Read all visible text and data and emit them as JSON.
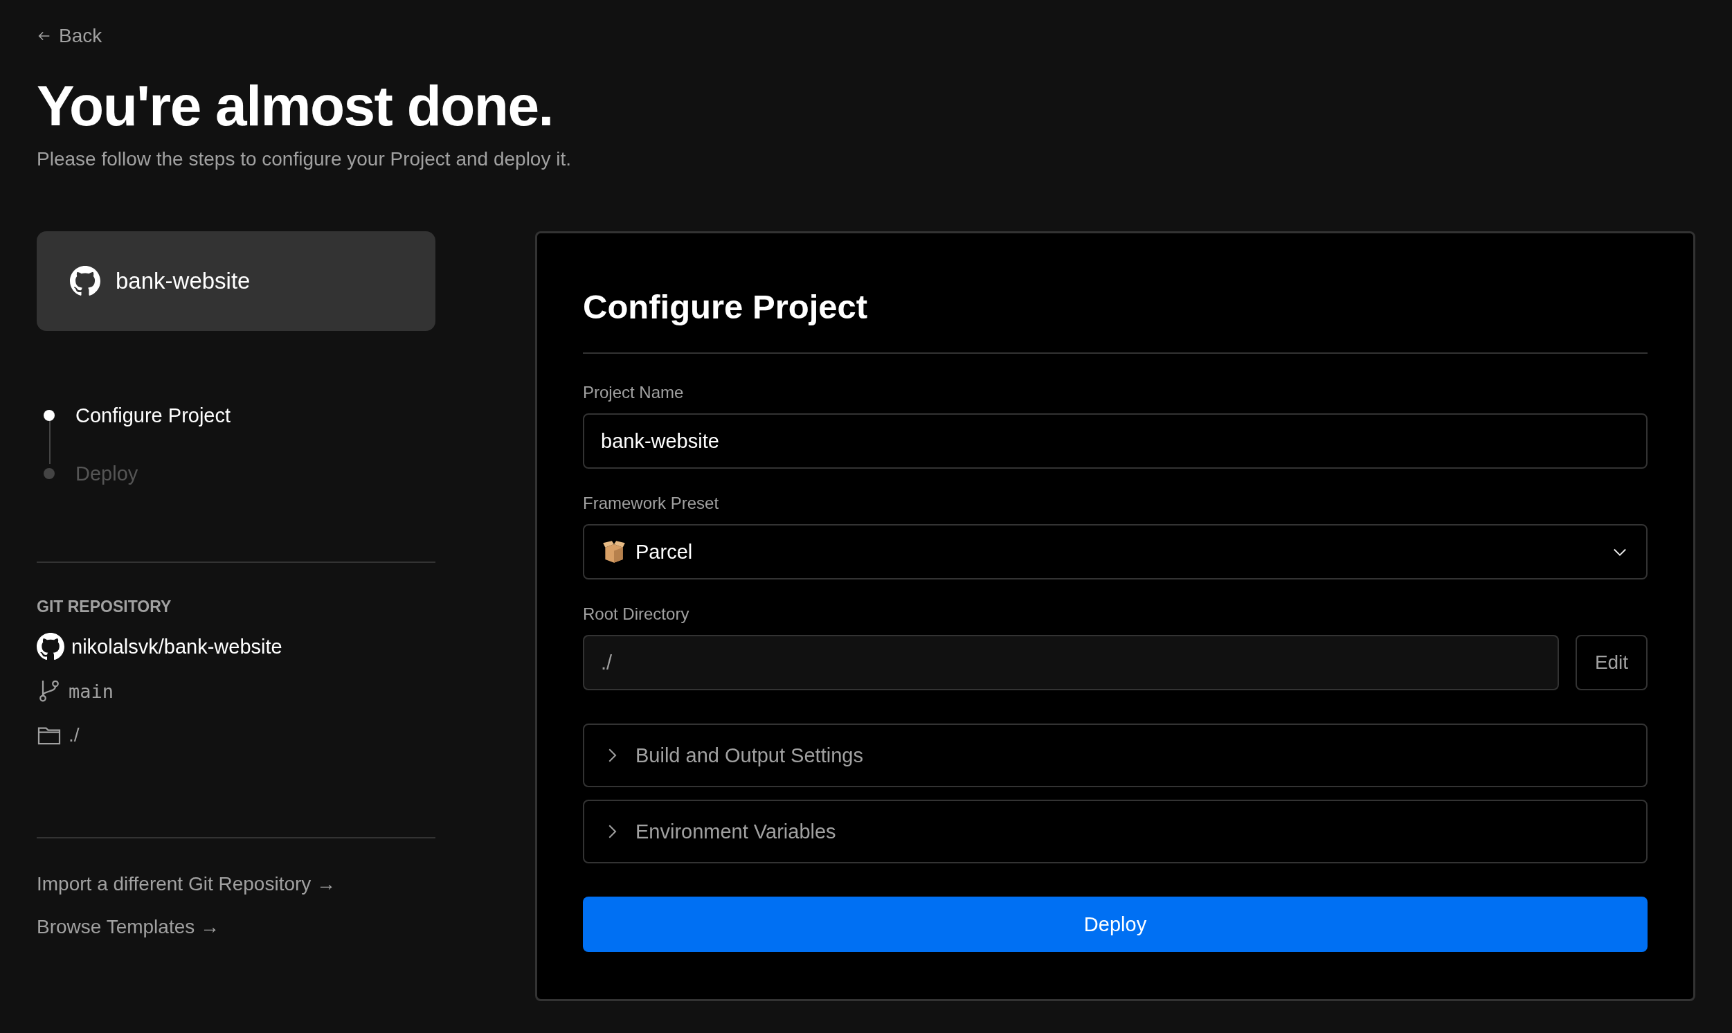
{
  "back_link": {
    "label": "Back"
  },
  "header": {
    "title": "You're almost done.",
    "subtitle": "Please follow the steps to configure your Project and deploy it."
  },
  "repo_card": {
    "name": "bank-website"
  },
  "steps": [
    {
      "label": "Configure Project",
      "selected": true
    },
    {
      "label": "Deploy",
      "selected": false
    }
  ],
  "git_repository": {
    "heading": "GIT REPOSITORY",
    "repo": "nikolalsvk/bank-website",
    "branch": "main",
    "directory": "./"
  },
  "links": [
    {
      "label": "Import a different Git Repository →"
    },
    {
      "label": "Browse Templates →"
    }
  ],
  "configure": {
    "title": "Configure Project",
    "project_name": {
      "label": "Project Name",
      "value": "bank-website"
    },
    "framework_preset": {
      "label": "Framework Preset",
      "value": "Parcel"
    },
    "root_directory": {
      "label": "Root Directory",
      "value": "./",
      "button": "Edit"
    },
    "sections": [
      {
        "label": "Build and Output Settings",
        "expanded": false
      },
      {
        "label": "Environment Variables",
        "expanded": false
      }
    ],
    "deploy_button": "Deploy"
  }
}
